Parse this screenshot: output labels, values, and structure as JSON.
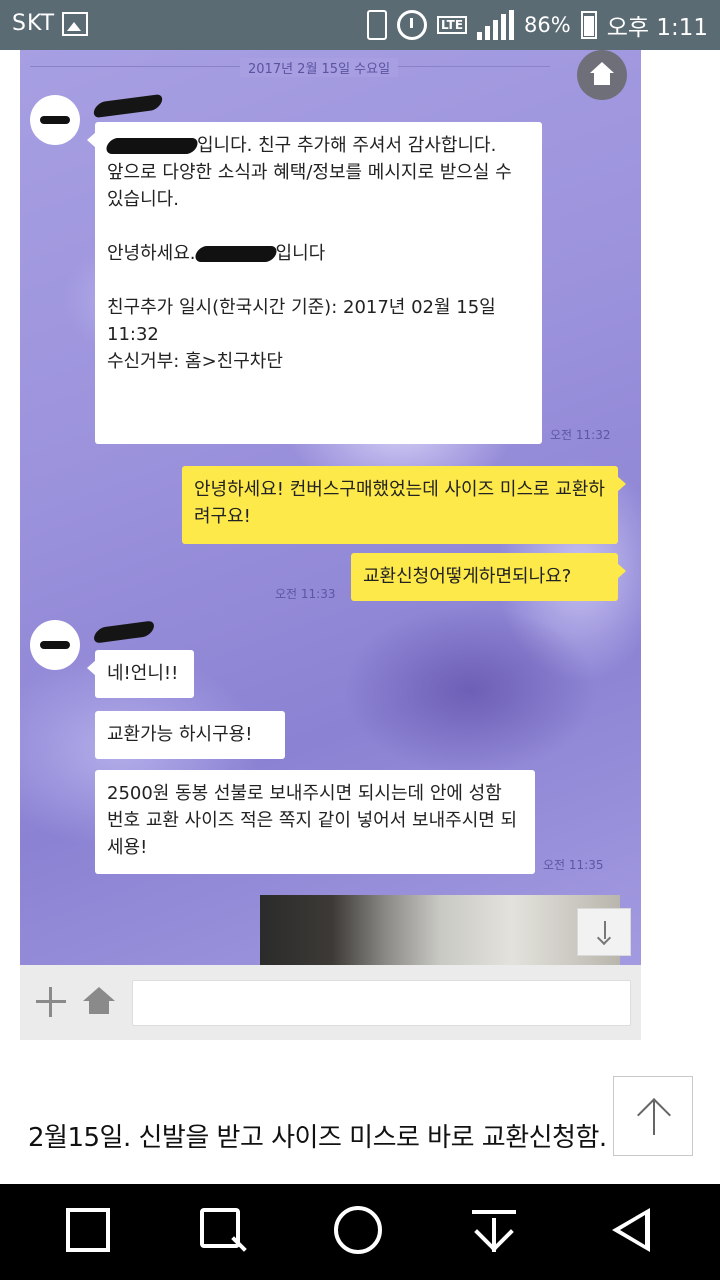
{
  "status_bar": {
    "carrier": "SKT",
    "lte": "LTE",
    "battery": "86%",
    "time": "오후 1:11",
    "icons": [
      "gallery-icon",
      "vibrate-icon",
      "alarm-icon",
      "lte-icon",
      "signal-icon",
      "battery-icon"
    ]
  },
  "chat": {
    "date": "2017년 2월 15일 수요일",
    "messages": [
      {
        "from": "other",
        "text": "입니다. 친구 추가해 주셔서 감사합니다.\n 앞으로 다양한 소식과 혜택/정보를 메시지로 받으실 수 있습니다.\n\n안녕하세요."
      },
      {
        "from": "other",
        "text_inline_end": "입니다"
      },
      {
        "from": "other",
        "text": "친구추가 일시(한국시간 기준): 2017년 02월 15일 11:32\n수신거부: 홈>친구차단",
        "time": "오전 11:32"
      },
      {
        "from": "me",
        "text": "안녕하세요! 컨버스구매했었는데 사이즈 미스로 교환하려구요!"
      },
      {
        "from": "me",
        "text": "교환신청어떻게하면되나요?",
        "time": "오전 11:33"
      },
      {
        "from": "other",
        "text": "네!언니!!"
      },
      {
        "from": "other",
        "text": "교환가능 하시구용!"
      },
      {
        "from": "other",
        "text": "2500원 동봉 선불로 보내주시면 되시는데 안에 성함 번호 교환 사이즈 적은 쪽지 같이 넣어서 보내주시면 되세용!",
        "time": "오전 11:35"
      }
    ]
  },
  "caption": "2월15일. 신발을 받고 사이즈 미스로 바로 교환신청함.",
  "colors": {
    "status_bar": "#5b6b73",
    "my_bubble": "#fde94a",
    "other_bubble": "#ffffff",
    "chat_bg": "#9b92dc"
  }
}
